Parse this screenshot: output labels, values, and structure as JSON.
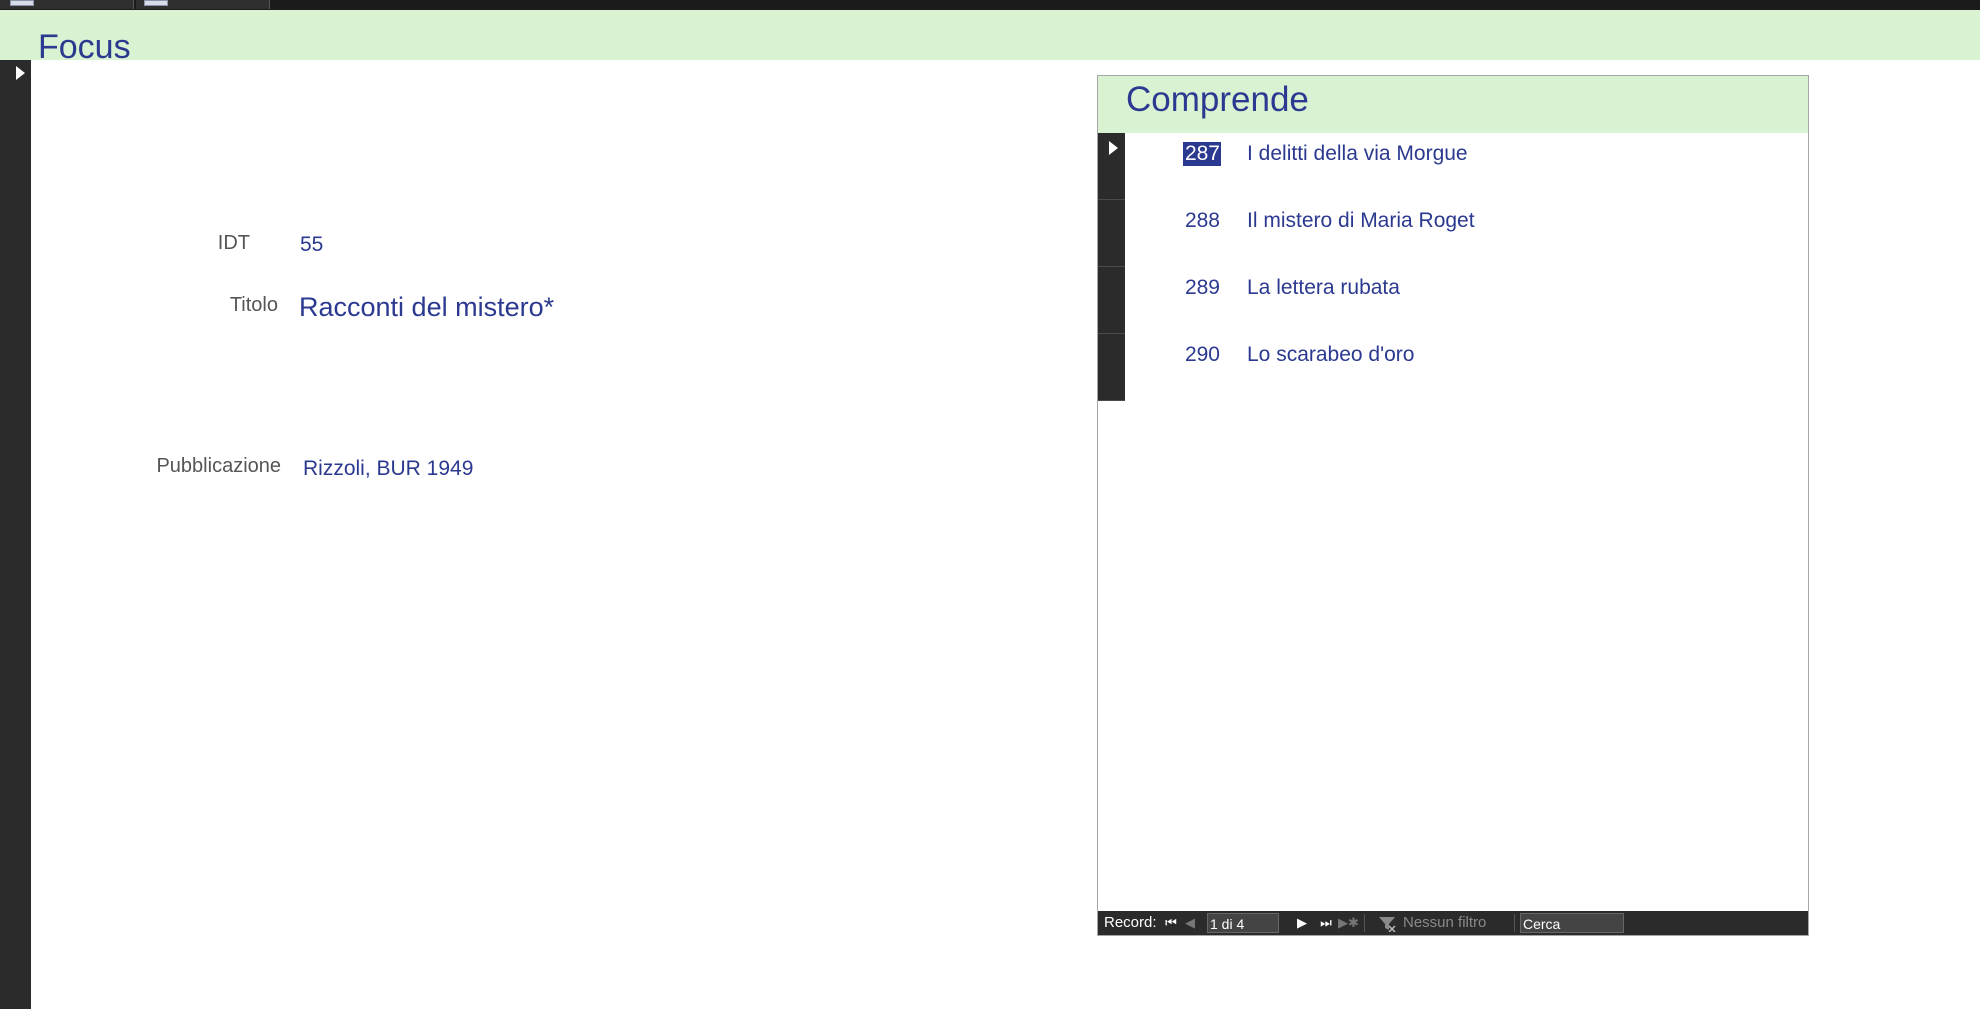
{
  "form": {
    "title": "Focus"
  },
  "fields": {
    "idt": {
      "label": "IDT",
      "value": "55"
    },
    "titolo": {
      "label": "Titolo",
      "value": "Racconti del mistero*"
    },
    "pubblicazione": {
      "label": "Pubblicazione",
      "value": "Rizzoli, BUR 1949"
    }
  },
  "subform": {
    "title": "Comprende",
    "rows": [
      {
        "id": "287",
        "title": "I delitti della via Morgue"
      },
      {
        "id": "288",
        "title": "Il mistero di Maria Roget"
      },
      {
        "id": "289",
        "title": "La lettera rubata"
      },
      {
        "id": "290",
        "title": "Lo scarabeo d'oro"
      }
    ],
    "nav": {
      "label": "Record:",
      "current": "1 di 4",
      "filter": "Nessun filtro",
      "search_placeholder": "Cerca"
    }
  },
  "colors": {
    "header_band": "#d9f2d2",
    "accent_text": "#2b3990",
    "selector_dark": "#2b2b2b"
  }
}
